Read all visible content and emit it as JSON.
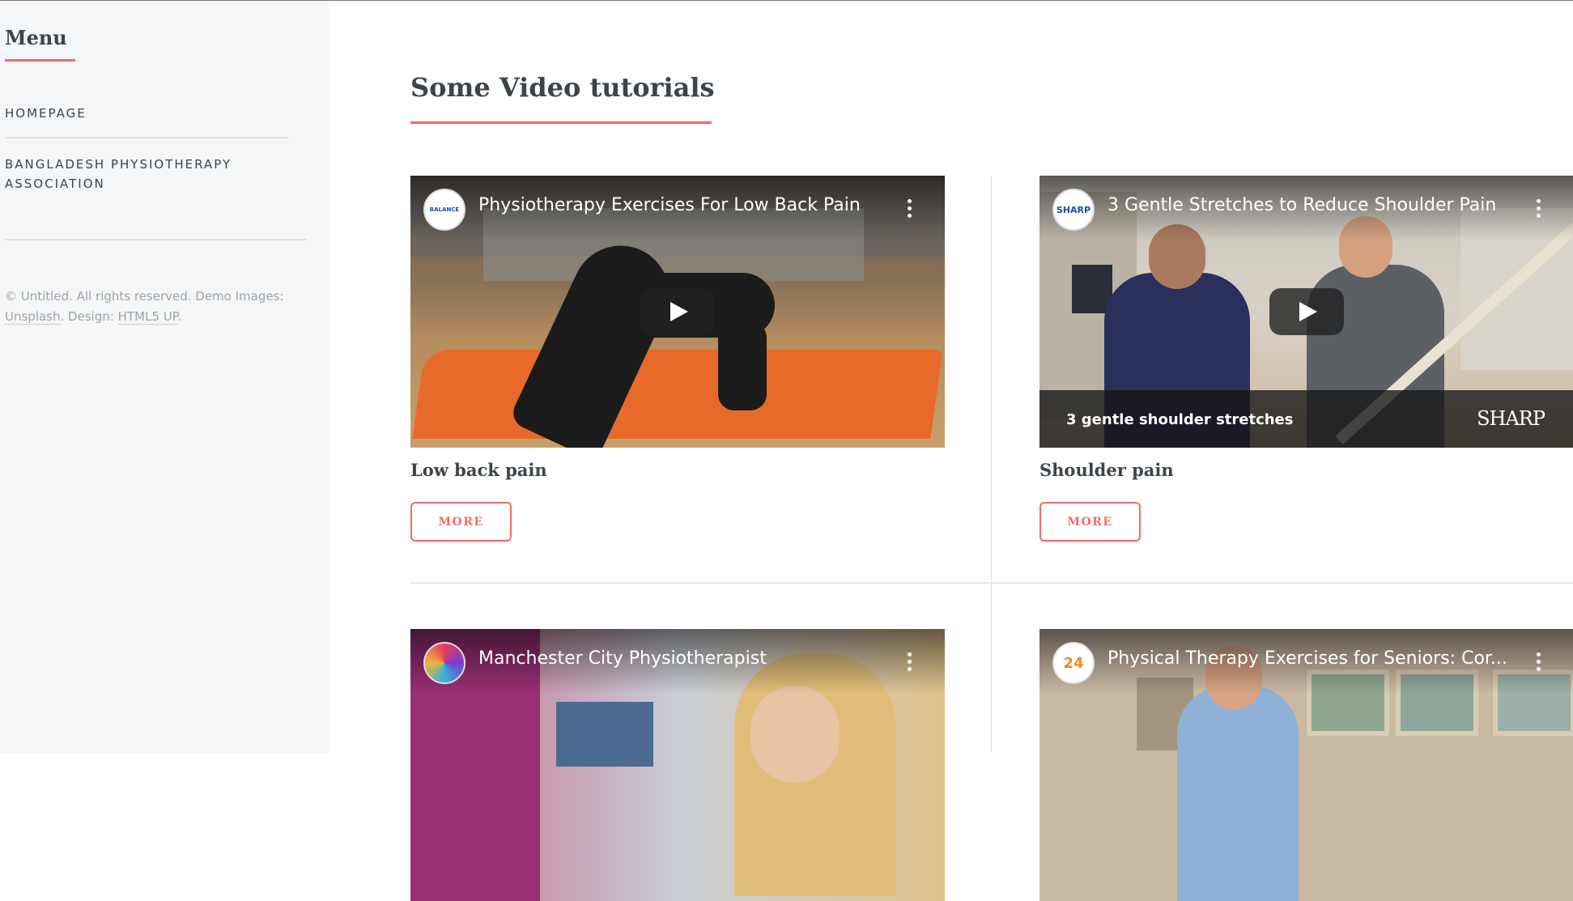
{
  "sidebar": {
    "menu_title": "Menu",
    "nav": [
      {
        "label": "HOMEPAGE"
      },
      {
        "label": "BANGLADESH PHYSIOTHERAPY ASSOCIATION"
      }
    ],
    "footer": {
      "text1": "© Untitled. All rights reserved. Demo Images: ",
      "link1": "Unsplash",
      "text2": ". Design: ",
      "link2": "HTML5 UP",
      "text3": "."
    }
  },
  "main": {
    "section_title": "Some Video tutorials",
    "cards": [
      {
        "video_title": "Physiotherapy Exercises For Low Back Pain",
        "channel": "BALANCE",
        "title": "Low back pain",
        "button": "MORE"
      },
      {
        "video_title": "3 Gentle Stretches to Reduce Shoulder Pain",
        "channel": "SHARP",
        "caption": "3 gentle shoulder stretches",
        "caption_brand": "SHARP",
        "title": "Shoulder pain",
        "button": "MORE"
      },
      {
        "video_title": "Manchester City Physiotherapist",
        "channel": ""
      },
      {
        "video_title": "Physical Therapy Exercises for Seniors: Cor...",
        "channel": "24"
      }
    ]
  },
  "colors": {
    "accent": "#f56a6a",
    "text": "#3d4449",
    "sidebar_bg": "#f5f6f7",
    "muted": "#9fa3a6"
  },
  "icons": [
    "kebab-menu-icon",
    "play-button-icon"
  ]
}
